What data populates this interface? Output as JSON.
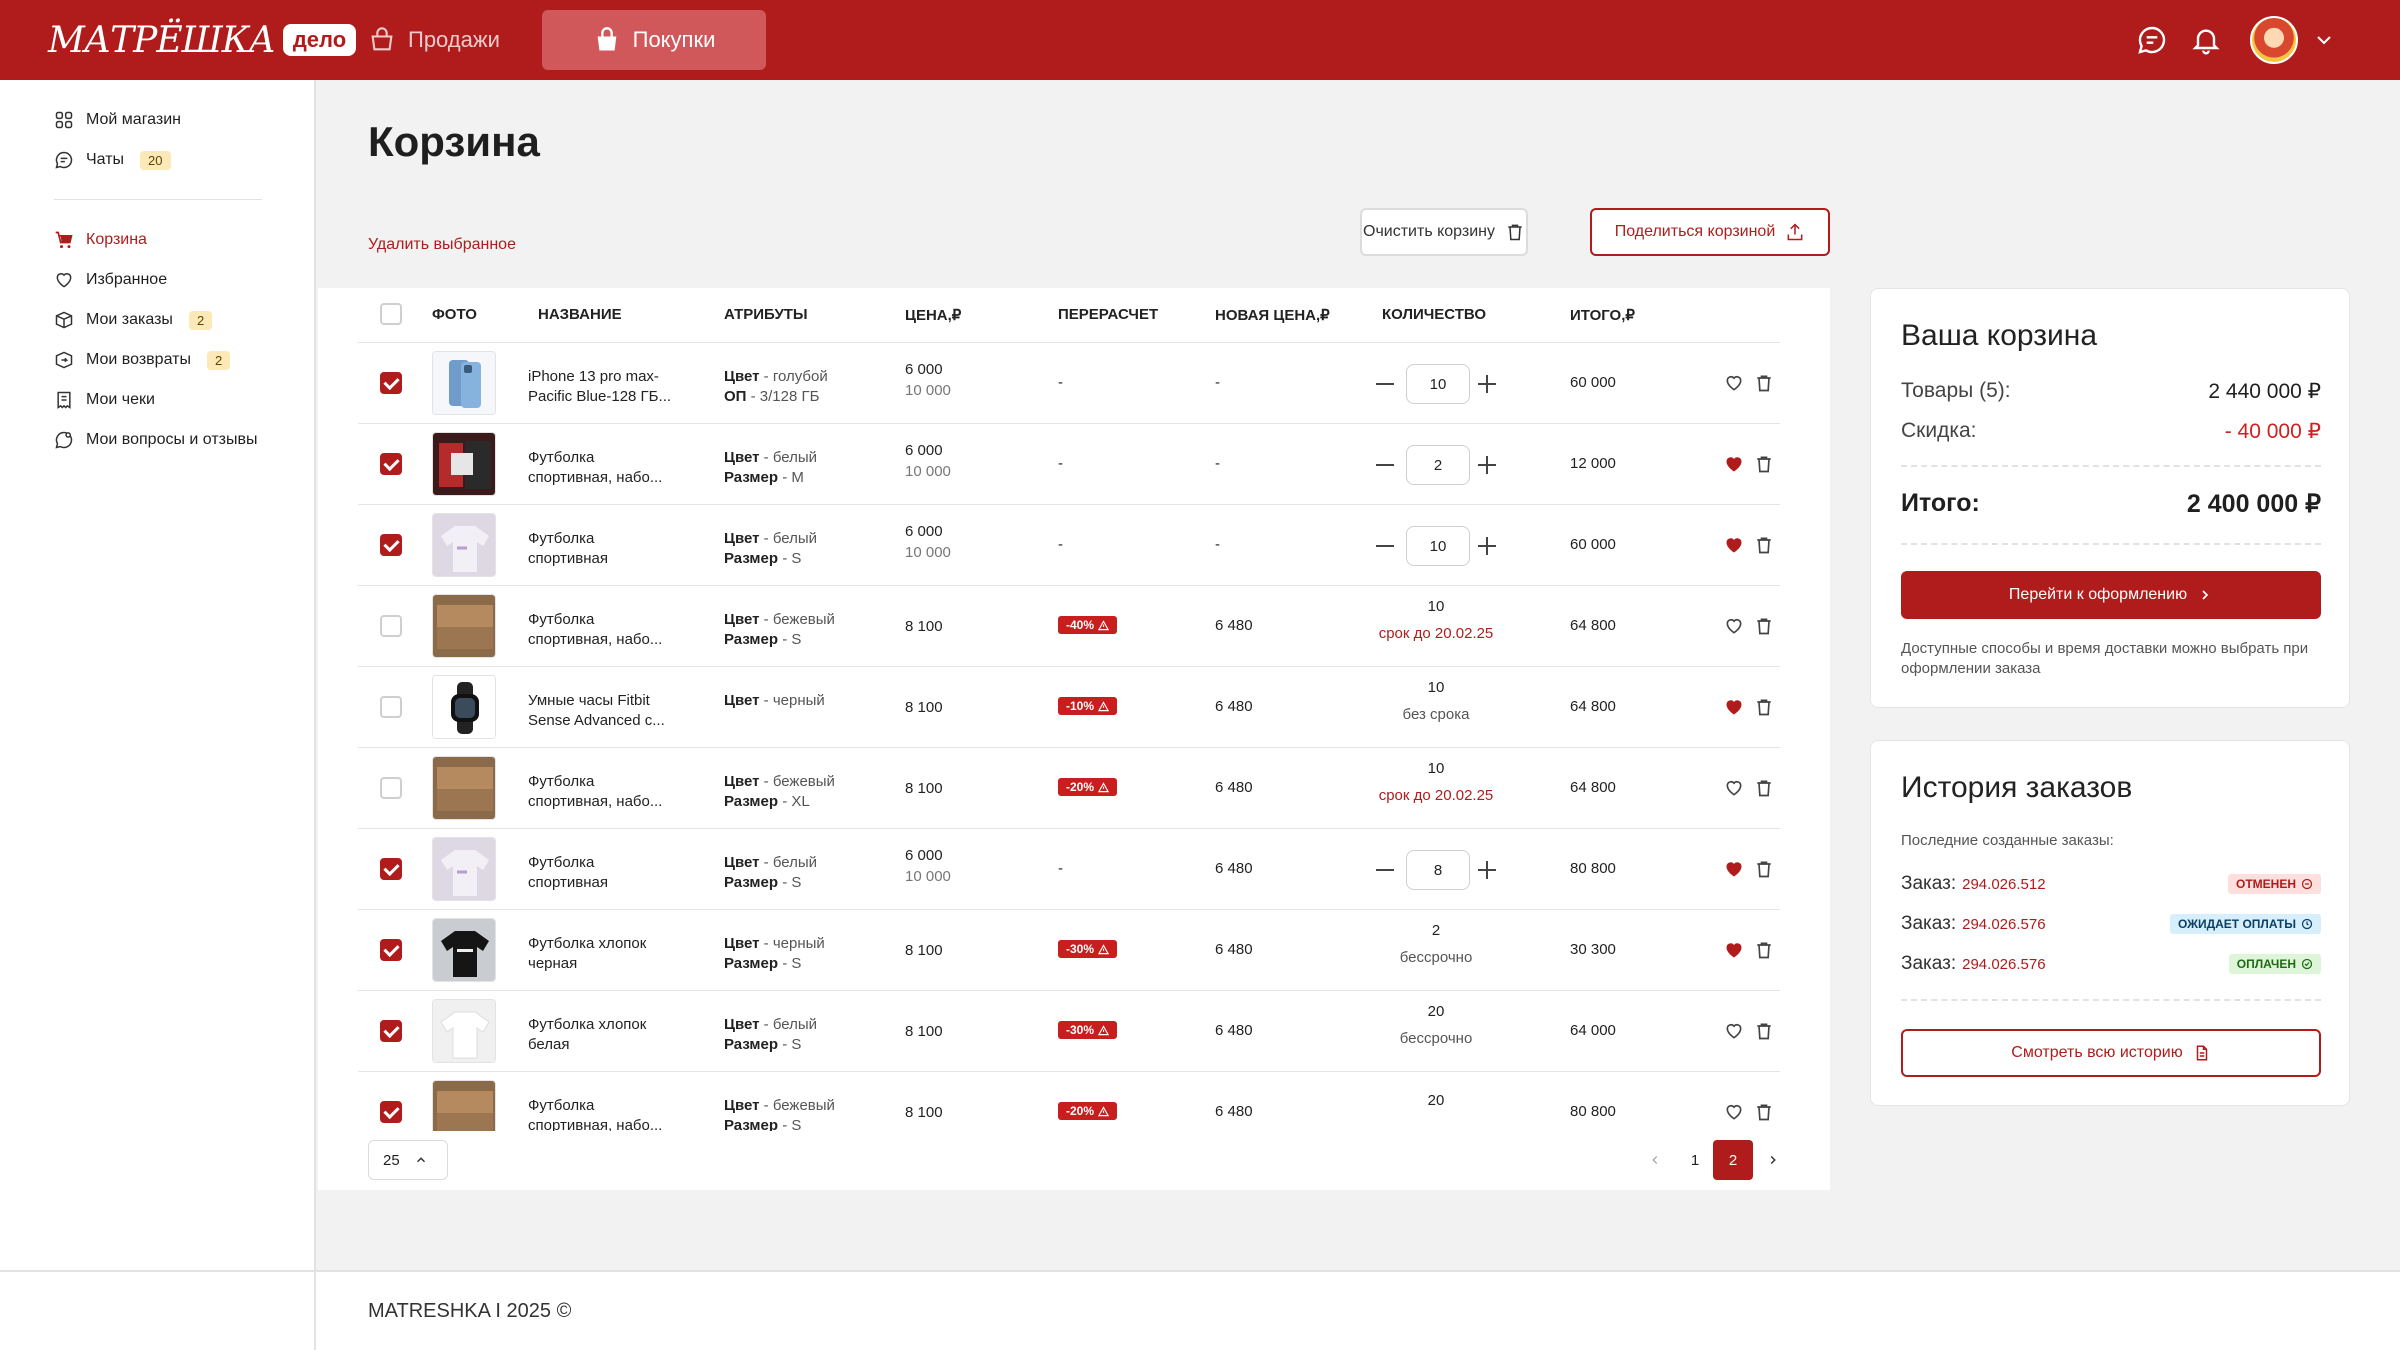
{
  "header": {
    "logo_text": "МАТРЁШКА",
    "logo_badge": "дело",
    "tabs": [
      {
        "label": "Продажи"
      },
      {
        "label": "Покупки"
      }
    ]
  },
  "sidebar": {
    "items": [
      {
        "label": "Мой магазин"
      },
      {
        "label": "Чаты",
        "badge": "20"
      },
      {
        "label": "Корзина"
      },
      {
        "label": "Избранное"
      },
      {
        "label": "Мои заказы",
        "badge": "2"
      },
      {
        "label": "Мои возвраты",
        "badge": "2"
      },
      {
        "label": "Мои чеки"
      },
      {
        "label": "Мои вопросы и отзывы"
      }
    ]
  },
  "page": {
    "title": "Корзина",
    "delete_selected": "Удалить выбранное",
    "clear_cart": "Очистить корзину",
    "share_cart": "Поделиться корзиной"
  },
  "table": {
    "headers": [
      "ФОТО",
      "НАЗВАНИЕ",
      "АТРИБУТЫ",
      "ЦЕНА,₽",
      "ПЕРЕРАСЧЕТ",
      "НОВАЯ ЦЕНА,₽",
      "КОЛИЧЕСТВО",
      "ИТОГО,₽"
    ],
    "rows": [
      {
        "checked": true,
        "photo": "phone-blue",
        "name": "iPhone 13 pro max-Pacific Blue-128 ГБ...",
        "attr1_k": "Цвет",
        "attr1_v": " - голубой",
        "attr2_k": "ОП",
        "attr2_v": " - 3/128 ГБ",
        "price": "6 000",
        "old_price": "10 000",
        "recalc": "-",
        "new_price": "-",
        "qty": "10",
        "qty_editable": true,
        "qty_note": "",
        "qty_note_color": "",
        "total": "60 000",
        "liked": false
      },
      {
        "checked": true,
        "photo": "set-dark",
        "name": "Футболка спортивная, набо...",
        "attr1_k": "Цвет",
        "attr1_v": " - белый",
        "attr2_k": "Размер",
        "attr2_v": " - M",
        "price": "6 000",
        "old_price": "10 000",
        "recalc": "-",
        "new_price": "-",
        "qty": "2",
        "qty_editable": true,
        "qty_note": "",
        "qty_note_color": "",
        "total": "12 000",
        "liked": true
      },
      {
        "checked": true,
        "photo": "tshirt-white",
        "name": "Футболка спортивная",
        "attr1_k": "Цвет",
        "attr1_v": " - белый",
        "attr2_k": "Размер",
        "attr2_v": " - S",
        "price": "6 000",
        "old_price": "10 000",
        "recalc": "-",
        "new_price": "-",
        "qty": "10",
        "qty_editable": true,
        "qty_note": "",
        "qty_note_color": "",
        "total": "60 000",
        "liked": true
      },
      {
        "checked": false,
        "photo": "tshirt-beige",
        "name": "Футболка спортивная, набо...",
        "attr1_k": "Цвет",
        "attr1_v": " - бежевый",
        "attr2_k": "Размер",
        "attr2_v": " - S",
        "price": "8 100",
        "old_price": "",
        "recalc": "-40%",
        "new_price": "6 480",
        "qty": "10",
        "qty_editable": false,
        "qty_note": "срок до 20.02.25",
        "qty_note_color": "red",
        "total": "64 800",
        "liked": false
      },
      {
        "checked": false,
        "photo": "watch",
        "name": "Умные часы Fitbit Sense Advanced с...",
        "attr1_k": "Цвет",
        "attr1_v": " - черный",
        "attr2_k": "",
        "attr2_v": "",
        "price": "8 100",
        "old_price": "",
        "recalc": "-10%",
        "new_price": "6 480",
        "qty": "10",
        "qty_editable": false,
        "qty_note": "без срока",
        "qty_note_color": "grey",
        "total": "64 800",
        "liked": true
      },
      {
        "checked": false,
        "photo": "tshirt-beige",
        "name": "Футболка спортивная, набо...",
        "attr1_k": "Цвет",
        "attr1_v": " - бежевый",
        "attr2_k": "Размер",
        "attr2_v": " -  XL",
        "price": "8 100",
        "old_price": "",
        "recalc": "-20%",
        "new_price": "6 480",
        "qty": "10",
        "qty_editable": false,
        "qty_note": "срок до 20.02.25",
        "qty_note_color": "red",
        "total": "64 800",
        "liked": false
      },
      {
        "checked": true,
        "photo": "tshirt-white",
        "name": "Футболка спортивная",
        "attr1_k": "Цвет",
        "attr1_v": " - белый",
        "attr2_k": "Размер",
        "attr2_v": " - S",
        "price": "6 000",
        "old_price": "10 000",
        "recalc": "-",
        "new_price": "6 480",
        "qty": "8",
        "qty_editable": true,
        "qty_note": "",
        "qty_note_color": "",
        "total": "80 800",
        "liked": true
      },
      {
        "checked": true,
        "photo": "tshirt-black",
        "name": "Футболка хлопок черная",
        "attr1_k": "Цвет",
        "attr1_v": " - черный",
        "attr2_k": "Размер",
        "attr2_v": " - S",
        "price": "8 100",
        "old_price": "",
        "recalc": "-30%",
        "new_price": "6 480",
        "qty": "2",
        "qty_editable": false,
        "qty_note": "бессрочно",
        "qty_note_color": "grey",
        "total": "30 300",
        "liked": true
      },
      {
        "checked": true,
        "photo": "tshirt-plain",
        "name": "Футболка хлопок белая",
        "attr1_k": "Цвет",
        "attr1_v": " - белый",
        "attr2_k": "Размер",
        "attr2_v": " - S",
        "price": "8 100",
        "old_price": "",
        "recalc": "-30%",
        "new_price": "6 480",
        "qty": "20",
        "qty_editable": false,
        "qty_note": "бессрочно",
        "qty_note_color": "grey",
        "total": "64 000",
        "liked": false
      },
      {
        "checked": true,
        "photo": "tshirt-beige",
        "name": "Футболка спортивная, набо...",
        "attr1_k": "Цвет",
        "attr1_v": " - бежевый",
        "attr2_k": "Размер",
        "attr2_v": " - S",
        "price": "8 100",
        "old_price": "",
        "recalc": "-20%",
        "new_price": "6 480",
        "qty": "20",
        "qty_editable": false,
        "qty_note": "",
        "qty_note_color": "",
        "total": "80 800",
        "liked": false
      }
    ]
  },
  "pagination": {
    "page_size": "25",
    "pages": [
      "1",
      "2"
    ],
    "current": "2"
  },
  "summary": {
    "title": "Ваша корзина",
    "goods_label": "Товары (5):",
    "goods_value": "2 440 000 ₽",
    "discount_label": "Скидка:",
    "discount_value": "- 40 000 ₽",
    "total_label": "Итого:",
    "total_value": "2 400 000 ₽",
    "checkout": "Перейти к оформлению",
    "note": "Доступные способы и время доставки можно выбрать при оформлении заказа"
  },
  "history": {
    "title": "История заказов",
    "subtitle": "Последние созданные заказы:",
    "orders": [
      {
        "label": "Заказ:",
        "number": "294.026.512",
        "status": "ОТМЕНЕН",
        "status_color": "#b01c1c"
      },
      {
        "label": "Заказ:",
        "number": "294.026.576",
        "status": "ОЖИДАЕТ ОПЛАТЫ",
        "status_color": "#0b3f66"
      },
      {
        "label": "Заказ:",
        "number": "294.026.576",
        "status": "ОПЛАЧЕН",
        "status_color": "#1f6b12"
      }
    ],
    "view_all": "Смотреть всю историю"
  },
  "footer": {
    "text": "MATRESHKA I 2025 ©"
  },
  "colors": {
    "brand": "#b01c1c",
    "accent_tab": "#d0585a",
    "badge": "#fde9b8"
  }
}
